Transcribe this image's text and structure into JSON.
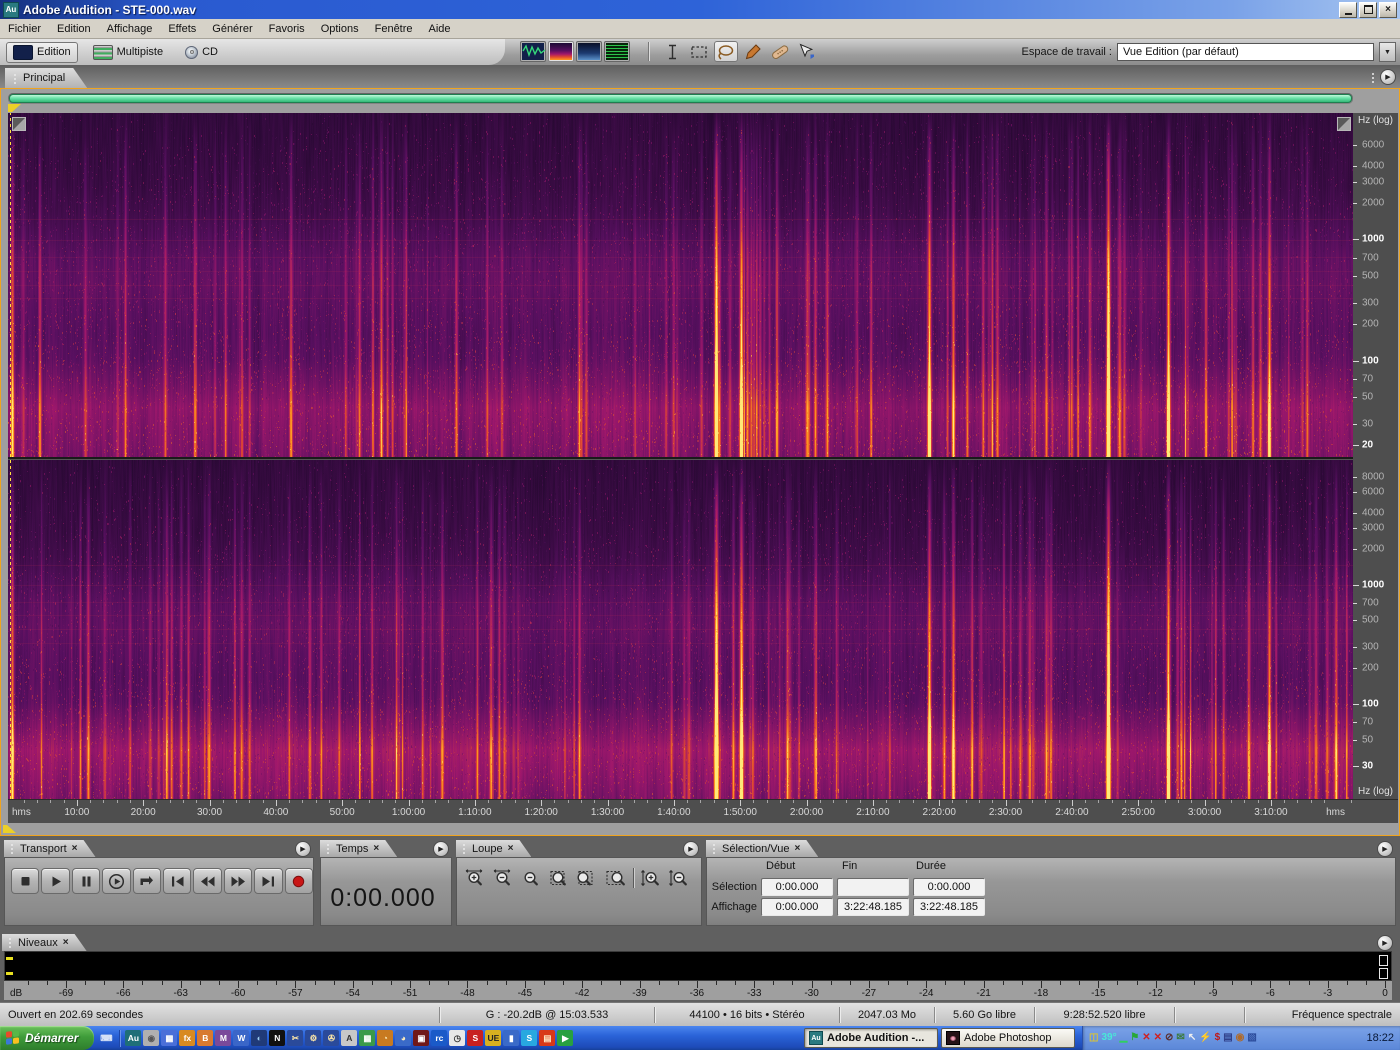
{
  "window": {
    "title": "Adobe Audition - STE-000.wav",
    "app_icon": "Au"
  },
  "ui": {
    "close_glyph": "×",
    "panel_menu_glyph": "▶",
    "dropdown_glyph": "▼",
    "au_glyph": "Au"
  },
  "colors": {
    "accent_border": "#f0a41e",
    "taskbar_blue": "#2a63d8",
    "start_green": "#3f9c3a",
    "meter_signal_yellow": "#e8e020",
    "spectral_palette": [
      "#140620",
      "#581060",
      "#a0186c",
      "#e04830",
      "#ff9820",
      "#ffe878"
    ]
  },
  "menu": {
    "items": [
      "Fichier",
      "Edition",
      "Affichage",
      "Effets",
      "Générer",
      "Favoris",
      "Options",
      "Fenêtre",
      "Aide"
    ]
  },
  "toolbar": {
    "mode_buttons": [
      "Edition",
      "Multipiste",
      "CD"
    ],
    "view_buttons": [
      "waveform-view",
      "spectral-frequency-view",
      "spectral-pan-view",
      "spectral-phase-view"
    ],
    "active_view": "spectral-frequency-view",
    "tools": [
      "time-selection-tool",
      "marquee-selection-tool",
      "lasso-selection-tool",
      "effects-paintbrush-tool",
      "spot-healing-brush-tool",
      "scrub-tool"
    ],
    "active_tool": "lasso-selection-tool",
    "workspace_label": "Espace de travail :",
    "workspace_value": "Vue Edition (par défaut)"
  },
  "main_tab": {
    "label": "Principal"
  },
  "spectral": {
    "axis_title": "Hz (log)",
    "top_channel_labels": [
      6000,
      4000,
      3000,
      2000,
      1000,
      700,
      500,
      300,
      200,
      100,
      70,
      50,
      30,
      20
    ],
    "top_channel_major": [
      1000,
      100,
      20
    ],
    "bottom_channel_labels": [
      8000,
      6000,
      4000,
      3000,
      2000,
      1000,
      700,
      500,
      300,
      200,
      100,
      70,
      50,
      30
    ],
    "bottom_channel_major": [
      1000,
      100,
      30
    ],
    "time_ruler": {
      "unit_label": "hms",
      "ticks": [
        "10:00",
        "20:00",
        "30:00",
        "40:00",
        "50:00",
        "1:00:00",
        "1:10:00",
        "1:20:00",
        "1:30:00",
        "1:40:00",
        "1:50:00",
        "2:00:00",
        "2:10:00",
        "2:20:00",
        "2:30:00",
        "2:40:00",
        "2:50:00",
        "3:00:00",
        "3:10:00"
      ]
    }
  },
  "panels": {
    "transport": {
      "title": "Transport",
      "buttons": [
        "stop",
        "play",
        "pause",
        "play-from-cursor",
        "loop-play",
        "go-to-beginning",
        "rewind",
        "fast-forward",
        "go-to-end",
        "record"
      ]
    },
    "temps": {
      "title": "Temps",
      "value": "0:00.000"
    },
    "loupe": {
      "title": "Loupe",
      "buttons": [
        "zoom-in-horizontal",
        "zoom-out-horizontal",
        "zoom-out-full",
        "zoom-to-selection",
        "zoom-selection-left-edge",
        "zoom-selection-right-edge",
        "zoom-in-vertical",
        "zoom-out-vertical"
      ]
    },
    "selection_vue": {
      "title": "Sélection/Vue",
      "columns": [
        "Début",
        "Fin",
        "Durée"
      ],
      "rows": {
        "selection": {
          "label": "Sélection",
          "debut": "0:00.000",
          "fin": "",
          "duree": "0:00.000"
        },
        "affichage": {
          "label": "Affichage",
          "debut": "0:00.000",
          "fin": "3:22:48.185",
          "duree": "3:22:48.185"
        }
      }
    },
    "niveaux": {
      "title": "Niveaux",
      "unit_label": "dB",
      "ticks": [
        -69,
        -66,
        -63,
        -60,
        -57,
        -54,
        -51,
        -48,
        -45,
        -42,
        -39,
        -36,
        -33,
        -30,
        -27,
        -24,
        -21,
        -18,
        -15,
        -12,
        -9,
        -6,
        -3,
        0
      ]
    }
  },
  "status_bar": {
    "segments": [
      "Ouvert en 202.69 secondes",
      "G : -20.2dB @ 15:03.533",
      "44100 • 16 bits • Stéréo",
      "2047.03 Mo",
      "5.60 Go libre",
      "9:28:52.520 libre",
      "",
      "Fréquence spectrale"
    ]
  },
  "taskbar": {
    "start_label": "Démarrer",
    "tasks": [
      {
        "label": "Adobe Audition -...",
        "active": true
      },
      {
        "label": "Adobe Photoshop",
        "active": false
      }
    ],
    "clock": "18:22",
    "quicklaunch": [
      {
        "name": "quicklaunch-keyboard-icon",
        "glyph": "⌨",
        "bg": "none",
        "fg": "#dce6f8"
      },
      {
        "name": "quicklaunch-separator",
        "glyph": "",
        "bg": "sep",
        "fg": ""
      },
      {
        "name": "quicklaunch-audition-icon",
        "glyph": "Au",
        "bg": "#1f6f78",
        "fg": "#ffffff"
      },
      {
        "name": "quicklaunch-icon",
        "glyph": "◉",
        "bg": "#b0b0b0",
        "fg": "#555555"
      },
      {
        "name": "quicklaunch-icon",
        "glyph": "▦",
        "bg": "#4a6fd8",
        "fg": "#ffffff"
      },
      {
        "name": "quicklaunch-icon",
        "glyph": "fx",
        "bg": "#d88a20",
        "fg": "#ffffff"
      },
      {
        "name": "quicklaunch-icon",
        "glyph": "B",
        "bg": "#d87a30",
        "fg": "#ffffff"
      },
      {
        "name": "quicklaunch-icon",
        "glyph": "M",
        "bg": "#7a4a9a",
        "fg": "#ffffff"
      },
      {
        "name": "quicklaunch-word-icon",
        "glyph": "W",
        "bg": "#3a66c8",
        "fg": "#ffffff"
      },
      {
        "name": "quicklaunch-internet-icon",
        "glyph": "◐",
        "bg": "#203a78",
        "fg": "#9cccee"
      },
      {
        "name": "quicklaunch-icon",
        "glyph": "N",
        "bg": "#111111",
        "fg": "#ffffff"
      },
      {
        "name": "quicklaunch-icon",
        "glyph": "✂",
        "bg": "#2a4a9a",
        "fg": "#ffe9a8"
      },
      {
        "name": "quicklaunch-icon",
        "glyph": "⚙",
        "bg": "#2a4a9a",
        "fg": "#ffe9a8"
      },
      {
        "name": "quicklaunch-icon",
        "glyph": "✇",
        "bg": "#2a4a9a",
        "fg": "#ffe9a8"
      },
      {
        "name": "quicklaunch-icon",
        "glyph": "A",
        "bg": "#c8c8c8",
        "fg": "#333333"
      },
      {
        "name": "quicklaunch-icon",
        "glyph": "▦",
        "bg": "#3a9a4a",
        "fg": "#ffffff"
      },
      {
        "name": "quicklaunch-icon",
        "glyph": "◔",
        "bg": "#c87a20",
        "fg": "#ffeebb"
      },
      {
        "name": "quicklaunch-icon",
        "glyph": "◕",
        "bg": "#3a6ac8",
        "fg": "#ffeebb"
      },
      {
        "name": "quicklaunch-icon",
        "glyph": "▣",
        "bg": "#701818",
        "fg": "#ffffff"
      },
      {
        "name": "quicklaunch-icon",
        "glyph": "rc",
        "bg": "#1a5ac8",
        "fg": "#ffffff"
      },
      {
        "name": "quicklaunch-icon",
        "glyph": "◷",
        "bg": "#e8e8e8",
        "fg": "#333333"
      },
      {
        "name": "quicklaunch-icon",
        "glyph": "S",
        "bg": "#c82020",
        "fg": "#ffffff"
      },
      {
        "name": "quicklaunch-icon",
        "glyph": "UE",
        "bg": "#d8b020",
        "fg": "#222222"
      },
      {
        "name": "quicklaunch-icon",
        "glyph": "▮",
        "bg": "#3a6ac8",
        "fg": "#ffffff"
      },
      {
        "name": "quicklaunch-icon",
        "glyph": "S",
        "bg": "#28a8e0",
        "fg": "#ffffff"
      },
      {
        "name": "quicklaunch-pdf-icon",
        "glyph": "▤",
        "bg": "#d83818",
        "fg": "#ffeecc"
      },
      {
        "name": "quicklaunch-icon",
        "glyph": "▶",
        "bg": "#28a040",
        "fg": "#ffffff"
      }
    ],
    "tray_items": [
      {
        "name": "tray-meter-icon",
        "glyph": "◫",
        "color": "#d8c238"
      },
      {
        "name": "tray-temperature-text",
        "glyph": "39°",
        "color": "#49e8d8"
      },
      {
        "name": "tray-minimized-icon",
        "glyph": "▁",
        "color": "#30d060"
      },
      {
        "name": "tray-flag-icon",
        "glyph": "⚑",
        "color": "#28a838"
      },
      {
        "name": "tray-network-error-icon",
        "glyph": "✕",
        "color": "#d02020"
      },
      {
        "name": "tray-network-error-icon",
        "glyph": "✕",
        "color": "#d02020"
      },
      {
        "name": "tray-blocked-icon",
        "glyph": "⊘",
        "color": "#5a3030"
      },
      {
        "name": "tray-mail-icon",
        "glyph": "✉",
        "color": "#3a7a3a"
      },
      {
        "name": "tray-pointer-icon",
        "glyph": "↖",
        "color": "#f0f0f0"
      },
      {
        "name": "tray-power-icon",
        "glyph": "⚡",
        "color": "#e03020"
      },
      {
        "name": "tray-money-icon",
        "glyph": "$",
        "color": "#c01818"
      },
      {
        "name": "tray-display-icon",
        "glyph": "▤",
        "color": "#30408a"
      },
      {
        "name": "tray-mouse-icon",
        "glyph": "◉",
        "color": "#b06a28"
      },
      {
        "name": "tray-document-icon",
        "glyph": "▧",
        "color": "#2a4a9a"
      }
    ]
  }
}
